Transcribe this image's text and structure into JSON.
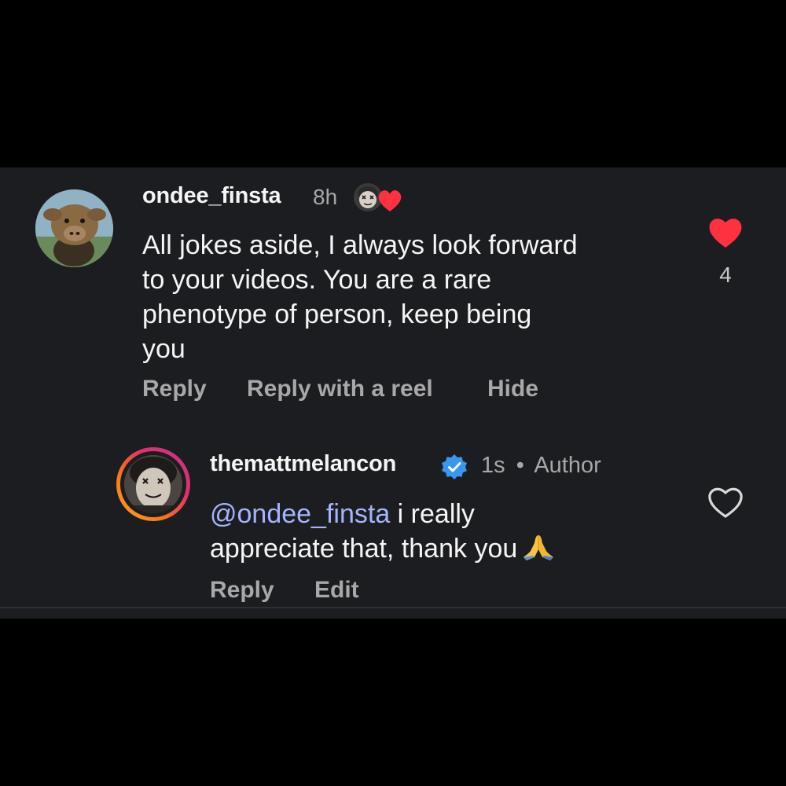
{
  "comment": {
    "username": "ondee_finsta",
    "time": "8h",
    "lines": [
      "All jokes aside, I always look forward",
      "to your videos. You are a rare",
      "phenotype of person, keep being",
      "you"
    ],
    "like_count": "4",
    "liked": true,
    "actions": {
      "reply": "Reply",
      "reply_with_reel": "Reply with a reel",
      "hide": "Hide"
    }
  },
  "reply": {
    "username": "themattmelancon",
    "verified": true,
    "time": "1s",
    "separator": "•",
    "badge": "Author",
    "mention": "@ondee_finsta",
    "text_line1": " i really",
    "text_line2": "appreciate that, thank you",
    "liked": false,
    "actions": {
      "reply": "Reply",
      "edit": "Edit"
    }
  },
  "icons": {
    "like_filled": "heart-filled-icon",
    "like_outline": "heart-outline-icon",
    "verified": "verified-badge-icon",
    "creator_liked": "creator-liked-icon",
    "emoji": "folded-hands-emoji"
  },
  "colors": {
    "background": "#000000",
    "panel": "#1c1d20",
    "text": "#f5f5f5",
    "secondary": "#a8a8a8",
    "like_red": "#ff3040",
    "mention": "#a5b4fc",
    "verified_blue": "#3897f0"
  }
}
